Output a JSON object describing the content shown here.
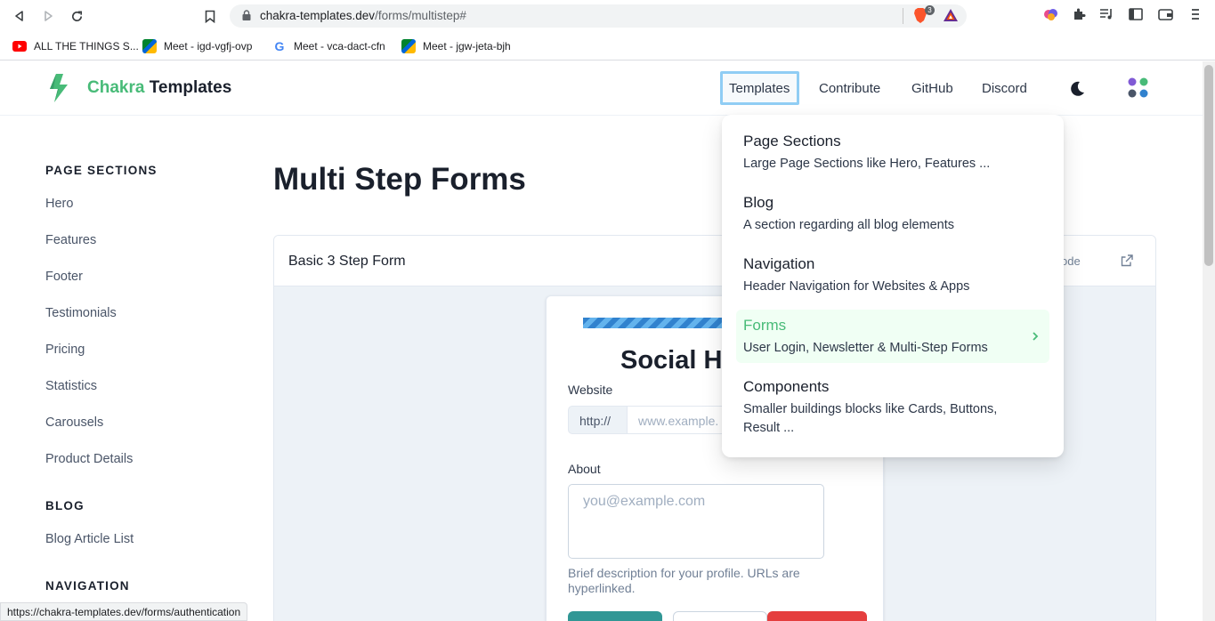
{
  "browser": {
    "url_host": "chakra-templates.dev",
    "url_path": "/forms/multistep#",
    "brave_badge_count": "3",
    "bookmarks": [
      {
        "label": "ALL THE THINGS S...",
        "icon": "youtube-icon"
      },
      {
        "label": "Meet - igd-vgfj-ovp",
        "icon": "meet-icon"
      },
      {
        "label": "Meet - vca-dact-cfn",
        "icon": "google-icon"
      },
      {
        "label": "Meet - jgw-jeta-bjh",
        "icon": "meet-icon"
      }
    ],
    "status_url": "https://chakra-templates.dev/forms/authentication"
  },
  "header": {
    "logo_accent": "Chakra",
    "logo_rest": " Templates",
    "nav": [
      "Templates",
      "Contribute",
      "GitHub",
      "Discord"
    ]
  },
  "sidebar": {
    "sections": [
      {
        "heading": "PAGE SECTIONS",
        "links": [
          "Hero",
          "Features",
          "Footer",
          "Testimonials",
          "Pricing",
          "Statistics",
          "Carousels",
          "Product Details"
        ]
      },
      {
        "heading": "BLOG",
        "links": [
          "Blog Article List"
        ]
      },
      {
        "heading": "NAVIGATION",
        "links": []
      }
    ]
  },
  "main": {
    "title": "Multi Step Forms",
    "card_title": "Basic 3 Step Form",
    "code_label": "ode",
    "form": {
      "title": "Social H",
      "website_label": "Website",
      "website_addon": "http://",
      "website_placeholder": "www.example.",
      "about_label": "About",
      "about_placeholder": "you@example.com",
      "helper": "Brief description for your profile. URLs are hyperlinked."
    }
  },
  "dropdown": {
    "items": [
      {
        "title": "Page Sections",
        "desc": "Large Page Sections like Hero, Features ..."
      },
      {
        "title": "Blog",
        "desc": "A section regarding all blog elements"
      },
      {
        "title": "Navigation",
        "desc": "Header Navigation for Websites & Apps"
      },
      {
        "title": "Forms",
        "desc": "User Login, Newsletter & Multi-Step Forms"
      },
      {
        "title": "Components",
        "desc": "Smaller buildings blocks like Cards, Buttons, Result ..."
      }
    ]
  },
  "colors": {
    "accent_green": "#48bb78",
    "teal_button": "#319795",
    "red_button": "#e53e3e"
  }
}
